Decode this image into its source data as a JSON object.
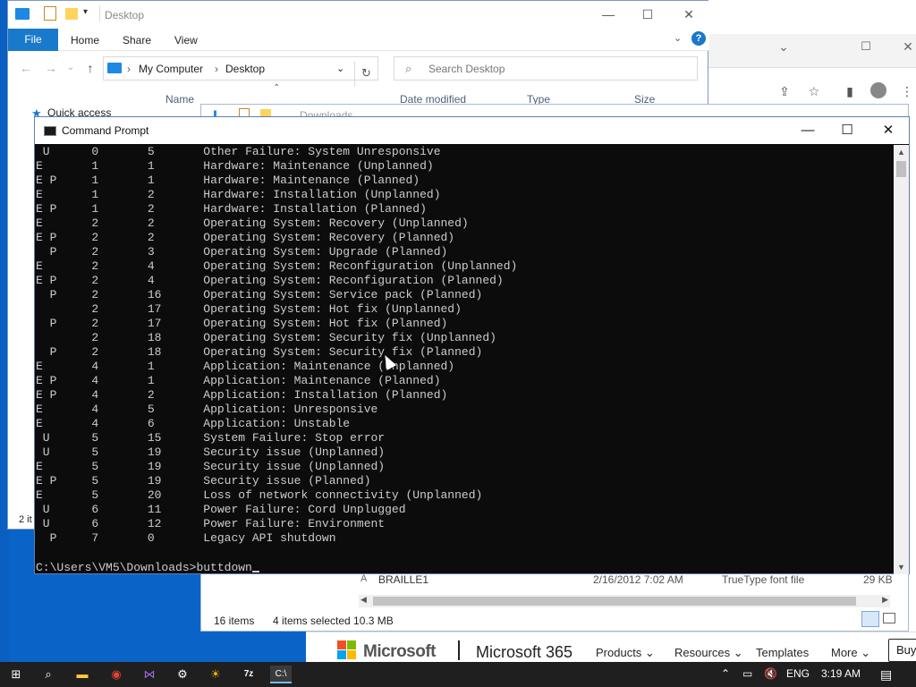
{
  "explorer": {
    "title": "Desktop",
    "ribbon_tabs": [
      "File",
      "Home",
      "Share",
      "View"
    ],
    "address": {
      "seg1": "My Computer",
      "seg2": "Desktop"
    },
    "search_placeholder": "Search Desktop",
    "col_name": "Name",
    "col_date": "Date modified",
    "col_type": "Type",
    "col_size": "Size",
    "quick_access": "Quick access",
    "status": "2 it"
  },
  "downloads": {
    "title": "Downloads",
    "file_row": {
      "name": "BRAILLE1",
      "date": "2/16/2012 7:02 AM",
      "type": "TrueType font file",
      "size": "29 KB"
    },
    "status_items": "16 items",
    "status_selected": "4 items selected  10.3 MB"
  },
  "cmd": {
    "title": "Command Prompt",
    "rows": [
      {
        "f": " U",
        "major": "0",
        "minor": "5",
        "reason": "Other Failure: System Unresponsive"
      },
      {
        "f": "E",
        "major": "1",
        "minor": "1",
        "reason": "Hardware: Maintenance (Unplanned)"
      },
      {
        "f": "E P",
        "major": "1",
        "minor": "1",
        "reason": "Hardware: Maintenance (Planned)"
      },
      {
        "f": "E",
        "major": "1",
        "minor": "2",
        "reason": "Hardware: Installation (Unplanned)"
      },
      {
        "f": "E P",
        "major": "1",
        "minor": "2",
        "reason": "Hardware: Installation (Planned)"
      },
      {
        "f": "E",
        "major": "2",
        "minor": "2",
        "reason": "Operating System: Recovery (Unplanned)"
      },
      {
        "f": "E P",
        "major": "2",
        "minor": "2",
        "reason": "Operating System: Recovery (Planned)"
      },
      {
        "f": "  P",
        "major": "2",
        "minor": "3",
        "reason": "Operating System: Upgrade (Planned)"
      },
      {
        "f": "E",
        "major": "2",
        "minor": "4",
        "reason": "Operating System: Reconfiguration (Unplanned)"
      },
      {
        "f": "E P",
        "major": "2",
        "minor": "4",
        "reason": "Operating System: Reconfiguration (Planned)"
      },
      {
        "f": "  P",
        "major": "2",
        "minor": "16",
        "reason": "Operating System: Service pack (Planned)"
      },
      {
        "f": "",
        "major": "2",
        "minor": "17",
        "reason": "Operating System: Hot fix (Unplanned)"
      },
      {
        "f": "  P",
        "major": "2",
        "minor": "17",
        "reason": "Operating System: Hot fix (Planned)"
      },
      {
        "f": "",
        "major": "2",
        "minor": "18",
        "reason": "Operating System: Security fix (Unplanned)"
      },
      {
        "f": "  P",
        "major": "2",
        "minor": "18",
        "reason": "Operating System: Security fix (Planned)"
      },
      {
        "f": "E",
        "major": "4",
        "minor": "1",
        "reason": "Application: Maintenance (Unplanned)"
      },
      {
        "f": "E P",
        "major": "4",
        "minor": "1",
        "reason": "Application: Maintenance (Planned)"
      },
      {
        "f": "E P",
        "major": "4",
        "minor": "2",
        "reason": "Application: Installation (Planned)"
      },
      {
        "f": "E",
        "major": "4",
        "minor": "5",
        "reason": "Application: Unresponsive"
      },
      {
        "f": "E",
        "major": "4",
        "minor": "6",
        "reason": "Application: Unstable"
      },
      {
        "f": " U",
        "major": "5",
        "minor": "15",
        "reason": "System Failure: Stop error"
      },
      {
        "f": " U",
        "major": "5",
        "minor": "19",
        "reason": "Security issue (Unplanned)"
      },
      {
        "f": "E",
        "major": "5",
        "minor": "19",
        "reason": "Security issue (Unplanned)"
      },
      {
        "f": "E P",
        "major": "5",
        "minor": "19",
        "reason": "Security issue (Planned)"
      },
      {
        "f": "E",
        "major": "5",
        "minor": "20",
        "reason": "Loss of network connectivity (Unplanned)"
      },
      {
        "f": " U",
        "major": "6",
        "minor": "11",
        "reason": "Power Failure: Cord Unplugged"
      },
      {
        "f": " U",
        "major": "6",
        "minor": "12",
        "reason": "Power Failure: Environment"
      },
      {
        "f": "  P",
        "major": "7",
        "minor": "0",
        "reason": "Legacy API shutdown"
      }
    ],
    "prompt": "C:\\Users\\VM5\\Downloads>",
    "input": "buttdown"
  },
  "microsoft": {
    "brand": "Microsoft",
    "product": "Microsoft 365",
    "nav": [
      "Products",
      "Resources",
      "Templates",
      "More"
    ],
    "buy": "Buy"
  },
  "tray": {
    "lang": "ENG",
    "time": "3:19 AM"
  },
  "colors": {
    "cmd_bg": "#0c0c0c",
    "cmd_fg": "#cccccc",
    "accent": "#1979ca",
    "taskbar": "#1f1f1f"
  }
}
